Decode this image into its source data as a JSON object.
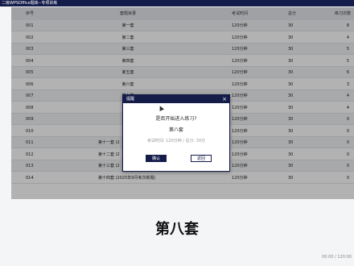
{
  "window": {
    "title": "二级WPSOffice题库--专项训练"
  },
  "table": {
    "headers": {
      "no": "序号",
      "category": "套题目录",
      "time": "考试时间",
      "score": "总分",
      "count": "练习次数"
    },
    "rows": [
      {
        "no": "001",
        "category": "第一套",
        "time": "120分钟",
        "score": "30",
        "count": "8"
      },
      {
        "no": "002",
        "category": "第二套",
        "time": "120分钟",
        "score": "30",
        "count": "4"
      },
      {
        "no": "003",
        "category": "第三套",
        "time": "120分钟",
        "score": "30",
        "count": "5"
      },
      {
        "no": "004",
        "category": "第四套",
        "time": "120分钟",
        "score": "30",
        "count": "5"
      },
      {
        "no": "005",
        "category": "第五套",
        "time": "120分钟",
        "score": "30",
        "count": "6"
      },
      {
        "no": "006",
        "category": "第六套",
        "time": "120分钟",
        "score": "30",
        "count": "3"
      },
      {
        "no": "007",
        "category": "第七套",
        "time": "120分钟",
        "score": "30",
        "count": "4"
      },
      {
        "no": "008",
        "category": "",
        "time": "120分钟",
        "score": "30",
        "count": "4"
      },
      {
        "no": "009",
        "category": "",
        "time": "120分钟",
        "score": "30",
        "count": "0"
      },
      {
        "no": "010",
        "category": "",
        "time": "120分钟",
        "score": "30",
        "count": "0"
      },
      {
        "no": "011",
        "category": "第十一套 (2",
        "time": "120分钟",
        "score": "30",
        "count": "0"
      },
      {
        "no": "012",
        "category": "第十二套 (2",
        "time": "120分钟",
        "score": "30",
        "count": "0"
      },
      {
        "no": "013",
        "category": "第十三套 (2",
        "time": "120分钟",
        "score": "30",
        "count": "0"
      },
      {
        "no": "014",
        "category": "第十四套 (2025年9月考次新题)",
        "time": "120分钟",
        "score": "30",
        "count": "0"
      }
    ]
  },
  "selected_title": "第八套",
  "timer": "00:00 / 120:00",
  "dialog": {
    "title": "提醒",
    "close": "×",
    "question": "是否开始进入练习?",
    "set_name": "第八套",
    "info": "考试时间: 120分钟 / 总分: 30分",
    "confirm_label": "确认",
    "back_label": "返回"
  }
}
